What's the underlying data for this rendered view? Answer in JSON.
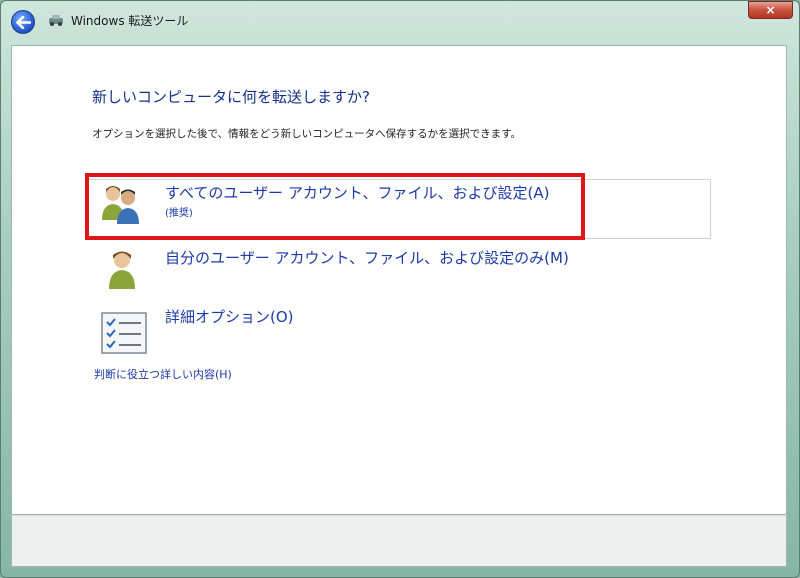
{
  "window": {
    "title": "Windows 転送ツール",
    "close_label": "×"
  },
  "icons": {
    "back": "back-arrow-icon",
    "app": "transfer-tool-icon",
    "close": "close-icon"
  },
  "main": {
    "heading": "新しいコンピュータに何を転送しますか?",
    "description": "オプションを選択した後で、情報をどう新しいコンピュータへ保存するかを選択できます。",
    "options": [
      {
        "label": "すべてのユーザー アカウント、ファイル、および設定(A)",
        "sublabel": "(推奨)",
        "icon": "users-icon"
      },
      {
        "label": "自分のユーザー アカウント、ファイル、および設定のみ(M)",
        "icon": "user-icon"
      },
      {
        "label": "詳細オプション(O)",
        "icon": "checklist-icon"
      }
    ],
    "help_link": "判断に役立つ詳しい内容(H)"
  },
  "colors": {
    "highlight": "#e0161b",
    "link": "#1c3aa8",
    "heading": "#15318a"
  }
}
